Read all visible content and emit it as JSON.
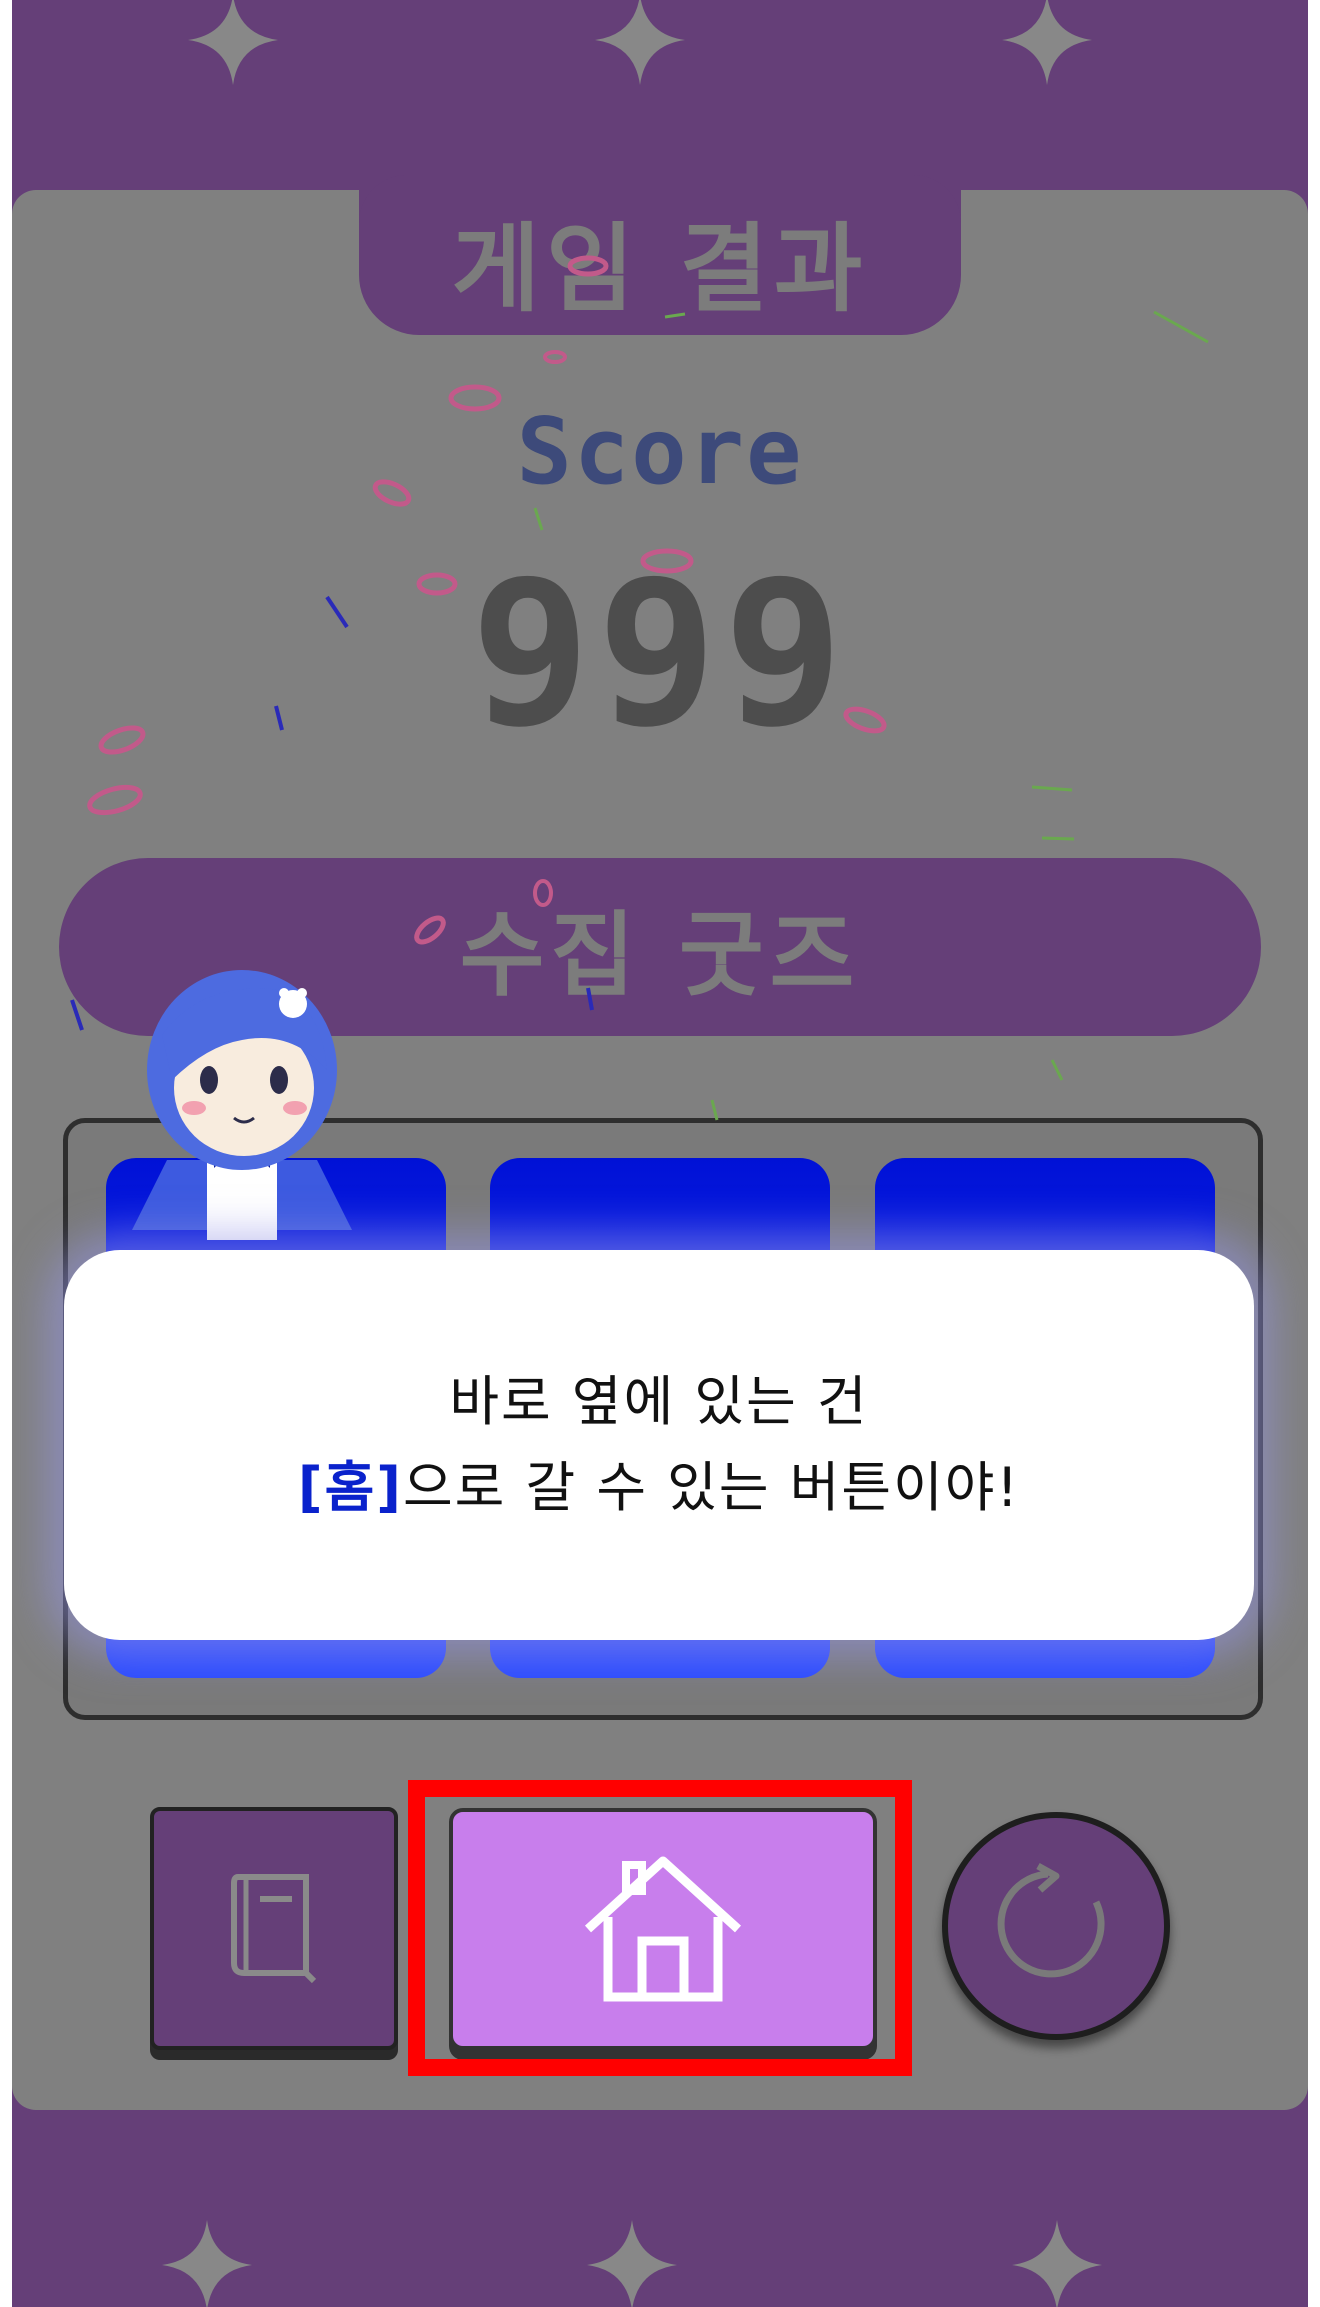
{
  "screen": {
    "title": "게임 결과",
    "score_label": "Score",
    "score_value": "999",
    "goods_title": "수집 굿즈"
  },
  "dialog": {
    "line1": "바로 옆에 있는 건",
    "line2_highlight": "[홈]",
    "line2_rest": "으로 갈 수 있는 버튼이야!"
  },
  "buttons": {
    "book_icon": "book-icon",
    "home_icon": "home-icon",
    "retry_icon": "retry-icon"
  },
  "colors": {
    "frame_purple": "#653f78",
    "panel_gray": "#808080",
    "slot_blue": "#1f3cff",
    "home_button": "#c87eec",
    "highlight_red": "#ff0000",
    "dialog_highlight": "#0a22cc"
  }
}
